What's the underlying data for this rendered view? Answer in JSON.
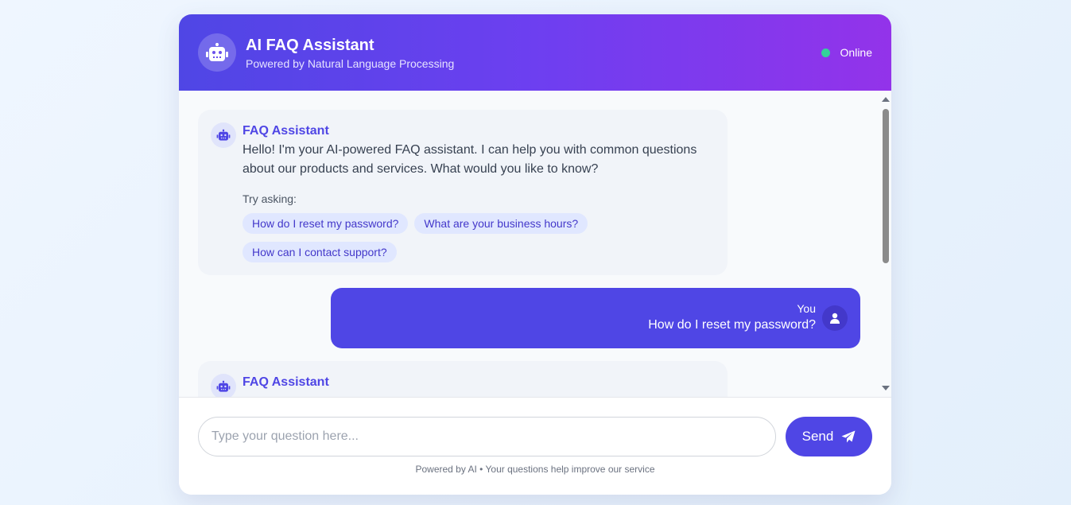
{
  "header": {
    "title": "AI FAQ Assistant",
    "subtitle": "Powered by Natural Language Processing",
    "status": "Online"
  },
  "messages": {
    "welcome": {
      "sender": "FAQ Assistant",
      "text": "Hello! I'm your AI-powered FAQ assistant. I can help you with common questions about our products and services. What would you like to know?",
      "try_label": "Try asking:",
      "suggestions": [
        "How do I reset my password?",
        "What are your business hours?",
        "How can I contact support?"
      ]
    },
    "user": {
      "sender": "You",
      "text": "How do I reset my password?"
    },
    "reply": {
      "sender": "FAQ Assistant"
    }
  },
  "input": {
    "placeholder": "Type your question here...",
    "value": ""
  },
  "send_label": "Send",
  "footnote": "Powered by AI • Your questions help improve our service",
  "colors": {
    "primary": "#4f46e5",
    "gradient_end": "#9333ea",
    "online": "#34d399"
  },
  "icons": {
    "assistant": "robot-icon",
    "user": "user-icon",
    "send": "paper-plane-icon"
  }
}
